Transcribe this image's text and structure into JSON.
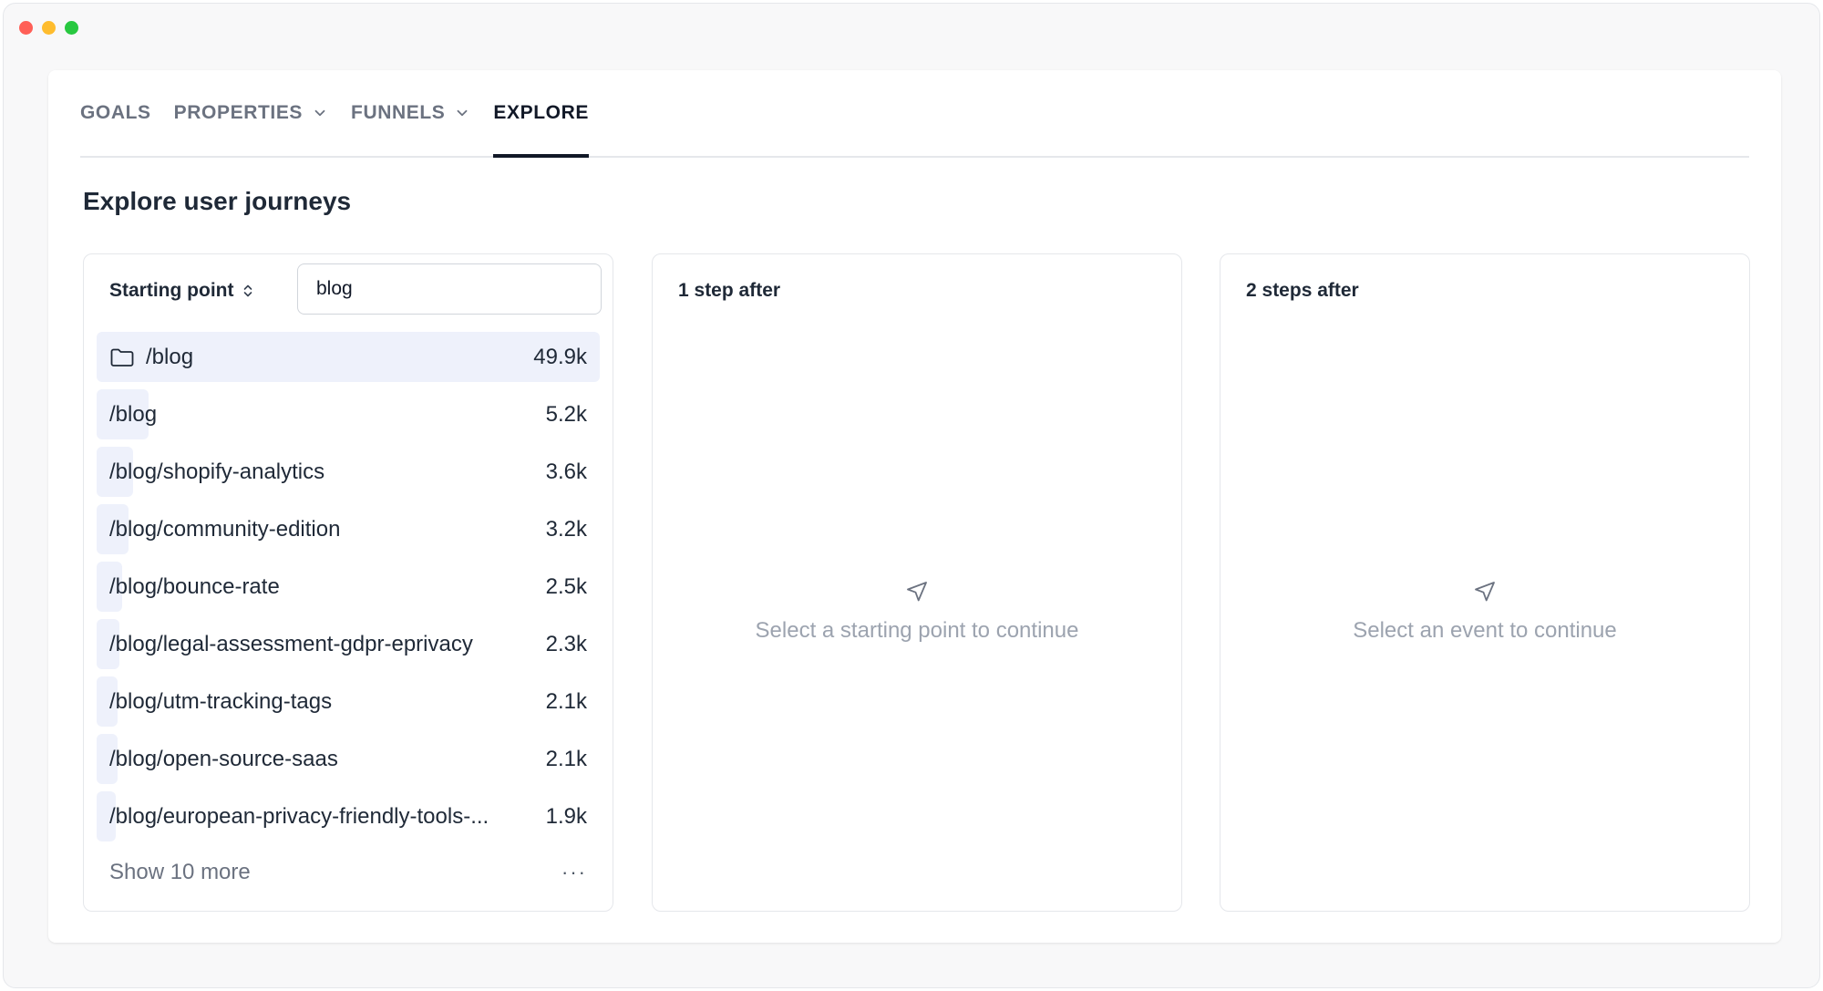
{
  "window": {
    "controls": [
      "close",
      "minimize",
      "maximize"
    ]
  },
  "tabs": [
    {
      "label": "GOALS",
      "has_dropdown": false,
      "active": false
    },
    {
      "label": "PROPERTIES",
      "has_dropdown": true,
      "active": false
    },
    {
      "label": "FUNNELS",
      "has_dropdown": true,
      "active": false
    },
    {
      "label": "EXPLORE",
      "has_dropdown": false,
      "active": true
    }
  ],
  "page": {
    "title": "Explore user journeys"
  },
  "starting_panel": {
    "title": "Starting point",
    "search_value": "blog",
    "selected": {
      "label": "/blog",
      "count": "49.9k",
      "icon": "folder-icon",
      "share": 1.0
    },
    "rows": [
      {
        "label": "/blog",
        "count": "5.2k",
        "share": 0.104
      },
      {
        "label": "/blog/shopify-analytics",
        "count": "3.6k",
        "share": 0.072
      },
      {
        "label": "/blog/community-edition",
        "count": "3.2k",
        "share": 0.064
      },
      {
        "label": "/blog/bounce-rate",
        "count": "2.5k",
        "share": 0.05
      },
      {
        "label": "/blog/legal-assessment-gdpr-eprivacy",
        "count": "2.3k",
        "share": 0.046
      },
      {
        "label": "/blog/utm-tracking-tags",
        "count": "2.1k",
        "share": 0.042
      },
      {
        "label": "/blog/open-source-saas",
        "count": "2.1k",
        "share": 0.042
      },
      {
        "label": "/blog/european-privacy-friendly-tools-...",
        "count": "1.9k",
        "share": 0.038
      }
    ],
    "show_more": "Show 10 more",
    "more_menu": "···"
  },
  "step1_panel": {
    "title": "1 step after",
    "empty_icon": "cursor-pointer-icon",
    "empty_text": "Select a starting point to continue"
  },
  "step2_panel": {
    "title": "2 steps after",
    "empty_icon": "cursor-pointer-icon",
    "empty_text": "Select an event to continue"
  },
  "colors": {
    "accent_bar": "#eef1fb",
    "active_tab": "#111827",
    "muted_text": "#9ca3af"
  }
}
